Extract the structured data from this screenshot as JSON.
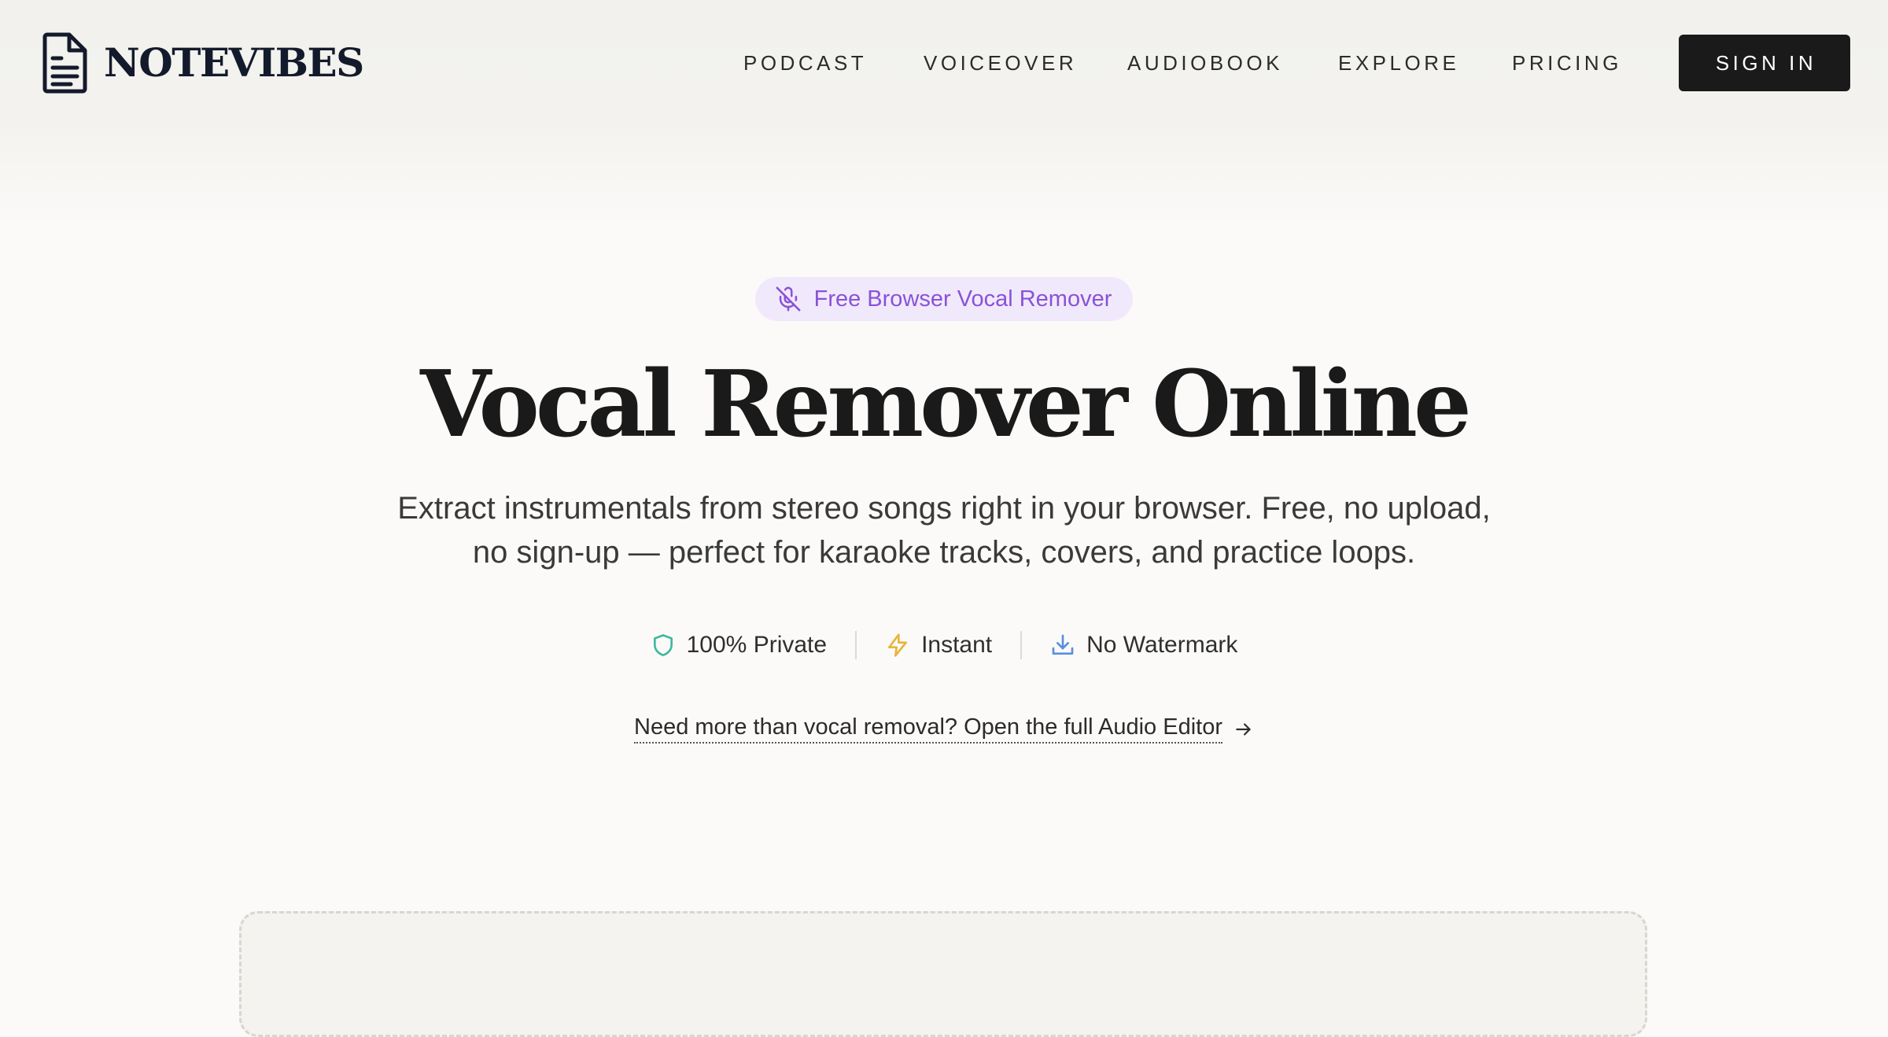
{
  "header": {
    "brand": "NOTEVIBES",
    "logo_icon": "document-icon",
    "nav": [
      {
        "label": "PODCAST"
      },
      {
        "label": "VOICEOVER"
      },
      {
        "label": "AUDIOBOOK"
      },
      {
        "label": "EXPLORE"
      },
      {
        "label": "PRICING"
      }
    ],
    "sign_in": "SIGN IN"
  },
  "hero": {
    "badge": {
      "label": "Free Browser Vocal Remover",
      "icon": "mic-off-icon",
      "color": "#8a52d8"
    },
    "title": "Vocal Remover Online",
    "subtitle_line1": "Extract instrumentals from stereo songs right in your browser. Free, no upload,",
    "subtitle_line2": "no sign-up — perfect for karaoke tracks, covers, and practice loops.",
    "features": [
      {
        "label": "100% Private",
        "icon": "shield-icon",
        "color": "#3fb9a0"
      },
      {
        "label": "Instant",
        "icon": "lightning-icon",
        "color": "#e8b53a"
      },
      {
        "label": "No Watermark",
        "icon": "download-icon",
        "color": "#5a8fe0"
      }
    ],
    "editor_link": "Need more than vocal removal? Open the full Audio Editor",
    "editor_link_icon": "arrow-right-icon"
  }
}
